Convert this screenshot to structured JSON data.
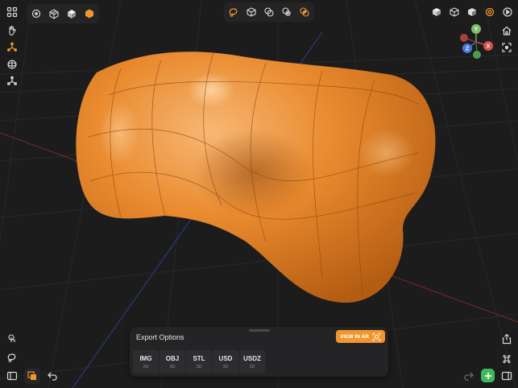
{
  "export_panel": {
    "title": "Export Options",
    "ar_button_label": "VIEW IN AR",
    "formats": [
      {
        "name": "IMG",
        "dim": "2D"
      },
      {
        "name": "OBJ",
        "dim": "3D"
      },
      {
        "name": "STL",
        "dim": "3D"
      },
      {
        "name": "USD",
        "dim": "3D"
      },
      {
        "name": "USDZ",
        "dim": "3D"
      }
    ]
  },
  "gizmo": {
    "y": "Y",
    "x": "X",
    "z": "Z"
  },
  "colors": {
    "accent": "#f0962d",
    "model": "#e98a2e",
    "add": "#3fb95a"
  },
  "icons": {
    "top_left": [
      "grid-icon",
      "point-mode-icon",
      "wire-box-icon",
      "solid-box-icon",
      "shaded-hex-icon"
    ],
    "top_center": [
      "lasso-select-icon",
      "cube-icon",
      "subtract-icon",
      "union-icon",
      "intersect-icon"
    ],
    "top_right": [
      "cube-solid-icon",
      "cube-outline-icon",
      "cube-shaded-icon",
      "render-settings-icon",
      "play-icon"
    ],
    "left_tools": [
      "hand-tool-icon",
      "move-axes-icon",
      "rotate-sphere-icon",
      "scale-axes-icon"
    ],
    "right_tools": [
      "home-icon",
      "focus-icon"
    ],
    "bottom_left": [
      "touch-icon",
      "lasso-icon",
      "sidebar-icon",
      "layers-icon",
      "undo-icon"
    ],
    "bottom_right": [
      "share-icon",
      "command-icon",
      "redo-icon",
      "add-icon",
      "panel-right-icon"
    ]
  }
}
